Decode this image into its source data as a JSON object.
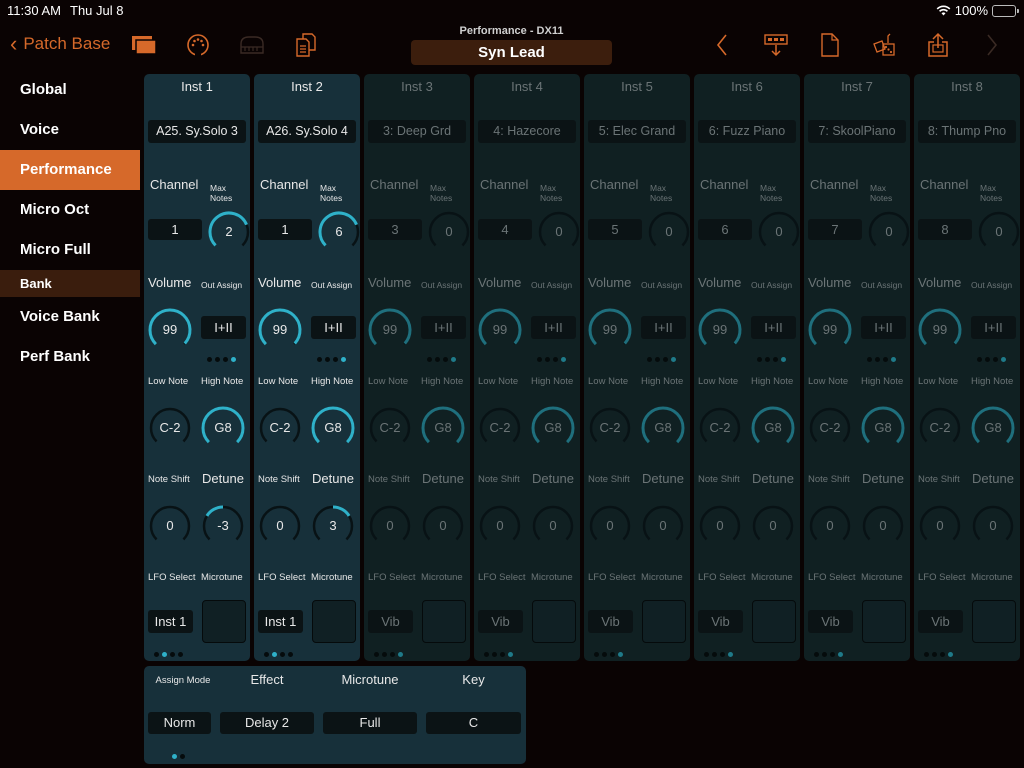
{
  "status_bar": {
    "time": "11:30 AM",
    "date": "Thu Jul 8",
    "battery": "100%",
    "battery_charging": true
  },
  "toolbar": {
    "back_label": "Patch Base",
    "subtitle": "Performance - DX11",
    "patch_name": "Syn Lead",
    "left_icons": [
      "folders-icon",
      "midi-port-icon",
      "keyboard-icon",
      "copy-docs-icon"
    ],
    "right_icons": [
      "prev-chevron-icon",
      "send-to-synth-icon",
      "new-document-icon",
      "random-dice-icon",
      "share-icon",
      "next-chevron-icon"
    ]
  },
  "colors": {
    "accent": "#d6692a",
    "knob": "#2fb1c9",
    "panel": "#17303a",
    "panel_dim": "#102022"
  },
  "sidebar": {
    "items": [
      {
        "label": "Global",
        "active": false
      },
      {
        "label": "Voice",
        "active": false
      },
      {
        "label": "Performance",
        "active": true
      },
      {
        "label": "Micro Oct",
        "active": false
      },
      {
        "label": "Micro Full",
        "active": false
      }
    ],
    "section_header": "Bank",
    "bank_items": [
      {
        "label": "Voice Bank"
      },
      {
        "label": "Perf Bank"
      }
    ]
  },
  "labels": {
    "channel": "Channel",
    "max_notes": "Max Notes",
    "volume": "Volume",
    "out_assign": "Out Assign",
    "low_note": "Low Note",
    "high_note": "High Note",
    "note_shift": "Note Shift",
    "detune": "Detune",
    "lfo_select": "LFO Select",
    "microtune": "Microtune"
  },
  "instruments": [
    {
      "name": "Inst 1",
      "patch": "A25. Sy.Solo 3",
      "channel": "1",
      "max_notes": "2",
      "max_notes_frac": 0.75,
      "volume": "99",
      "out_assign": "I+II",
      "out_dot": 3,
      "low_note": "C-2",
      "high_note": "G8",
      "note_shift": "0",
      "detune": "-3",
      "lfo_select": "Inst 1",
      "page_dot": 1,
      "active": true
    },
    {
      "name": "Inst 2",
      "patch": "A26. Sy.Solo 4",
      "channel": "1",
      "max_notes": "6",
      "max_notes_frac": 0.75,
      "volume": "99",
      "out_assign": "I+II",
      "out_dot": 3,
      "low_note": "C-2",
      "high_note": "G8",
      "note_shift": "0",
      "detune": "3",
      "lfo_select": "Inst 1",
      "page_dot": 1,
      "active": true
    },
    {
      "name": "Inst 3",
      "patch": "3: Deep Grd",
      "channel": "3",
      "max_notes": "0",
      "max_notes_frac": 0,
      "volume": "99",
      "out_assign": "I+II",
      "out_dot": 3,
      "low_note": "C-2",
      "high_note": "G8",
      "note_shift": "0",
      "detune": "0",
      "lfo_select": "Vib",
      "page_dot": 3,
      "active": false
    },
    {
      "name": "Inst 4",
      "patch": "4: Hazecore",
      "channel": "4",
      "max_notes": "0",
      "max_notes_frac": 0,
      "volume": "99",
      "out_assign": "I+II",
      "out_dot": 3,
      "low_note": "C-2",
      "high_note": "G8",
      "note_shift": "0",
      "detune": "0",
      "lfo_select": "Vib",
      "page_dot": 3,
      "active": false
    },
    {
      "name": "Inst 5",
      "patch": "5: Elec Grand",
      "channel": "5",
      "max_notes": "0",
      "max_notes_frac": 0,
      "volume": "99",
      "out_assign": "I+II",
      "out_dot": 3,
      "low_note": "C-2",
      "high_note": "G8",
      "note_shift": "0",
      "detune": "0",
      "lfo_select": "Vib",
      "page_dot": 3,
      "active": false
    },
    {
      "name": "Inst 6",
      "patch": "6: Fuzz Piano",
      "channel": "6",
      "max_notes": "0",
      "max_notes_frac": 0,
      "volume": "99",
      "out_assign": "I+II",
      "out_dot": 3,
      "low_note": "C-2",
      "high_note": "G8",
      "note_shift": "0",
      "detune": "0",
      "lfo_select": "Vib",
      "page_dot": 3,
      "active": false
    },
    {
      "name": "Inst 7",
      "patch": "7: SkoolPiano",
      "channel": "7",
      "max_notes": "0",
      "max_notes_frac": 0,
      "volume": "99",
      "out_assign": "I+II",
      "out_dot": 3,
      "low_note": "C-2",
      "high_note": "G8",
      "note_shift": "0",
      "detune": "0",
      "lfo_select": "Vib",
      "page_dot": 3,
      "active": false
    },
    {
      "name": "Inst 8",
      "patch": "8: Thump Pno",
      "channel": "8",
      "max_notes": "0",
      "max_notes_frac": 0,
      "volume": "99",
      "out_assign": "I+II",
      "out_dot": 3,
      "low_note": "C-2",
      "high_note": "G8",
      "note_shift": "0",
      "detune": "0",
      "lfo_select": "Vib",
      "page_dot": 3,
      "active": false
    }
  ],
  "global_panel": {
    "assign_mode_label": "Assign Mode",
    "assign_mode": "Norm",
    "effect_label": "Effect",
    "effect": "Delay 2",
    "microtune_label": "Microtune",
    "microtune": "Full",
    "key_label": "Key",
    "key": "C",
    "page_dot": 0
  }
}
